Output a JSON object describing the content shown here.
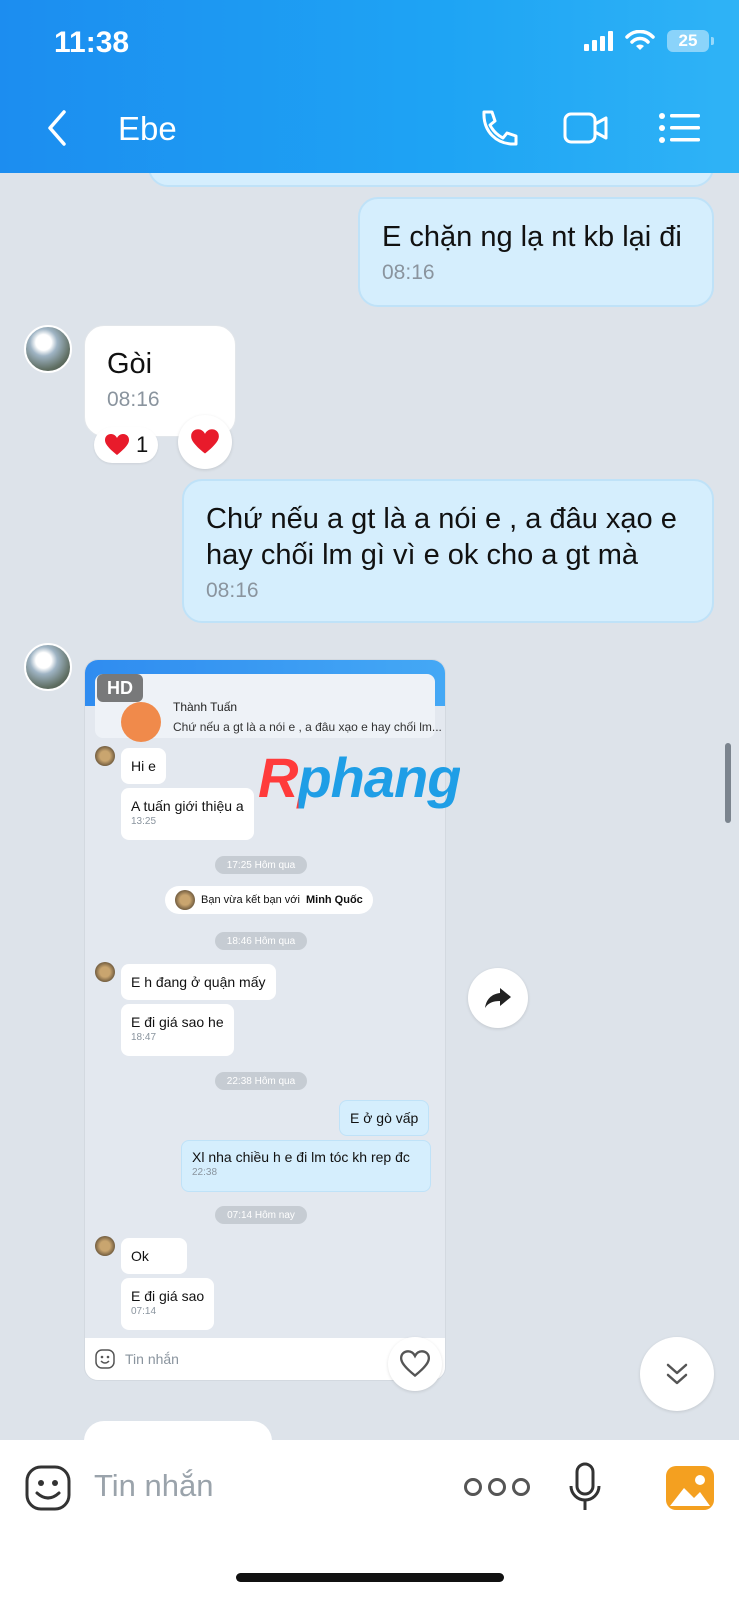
{
  "status_bar": {
    "time": "11:38",
    "battery": "25"
  },
  "header": {
    "contact_name": "Ebe"
  },
  "messages": [
    {
      "dir": "out",
      "text": "E chặn ng lạ nt kb lại đi",
      "time": "08:16"
    },
    {
      "dir": "in",
      "text": "Gòi",
      "time": "08:16",
      "reaction_count": "1"
    },
    {
      "dir": "out",
      "text": "Chứ nếu a gt là a nói e , a đâu xạo e hay chối lm gì vì e ok cho a gt mà",
      "time": "08:16"
    }
  ],
  "embedded": {
    "hd_badge": "HD",
    "quote_name": "Thành Tuấn",
    "quote_text": "Chứ nếu a gt là a nói e , a đâu xạo e hay chối lm...",
    "msgs": {
      "hi": "Hi e",
      "tuan": "A tuấn giới thiệu a",
      "tuan_time": "13:25",
      "pill1": "17:25 Hôm qua",
      "sys_prefix": "Bạn vừa kết bạn với",
      "sys_name": "Minh Quốc",
      "pill2": "18:46 Hôm qua",
      "quan": "E h đang ở quận mấy",
      "gia": "E đi giá sao he",
      "gia_time": "18:47",
      "pill3": "22:38 Hôm qua",
      "govap": "E ở gò vấp",
      "xl": "Xl nha chiều h e đi lm tóc kh rep đc",
      "xl_time": "22:38",
      "pill4": "07:14 Hôm nay",
      "ok": "Ok",
      "gia2": "E đi giá sao",
      "gia2_time": "07:14"
    },
    "input_placeholder": "Tin nhắn"
  },
  "watermark": "Rphang",
  "composer": {
    "placeholder": "Tin nhắn"
  },
  "colors": {
    "header_blue": "#1c8df0",
    "outgoing_bubble": "#d5eefd",
    "reaction_red": "#e81b2b"
  }
}
